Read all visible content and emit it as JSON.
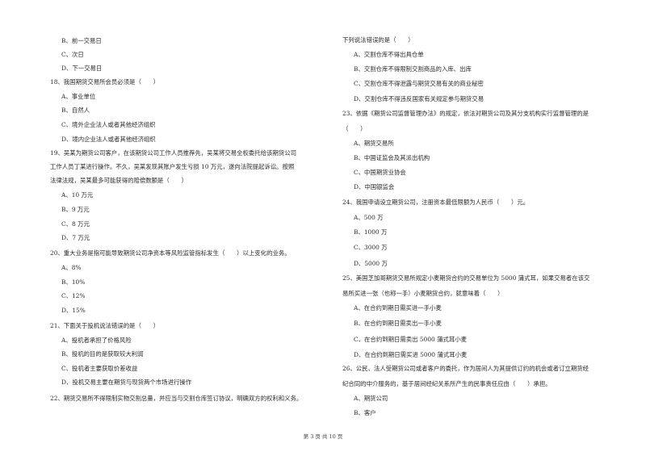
{
  "left_column": [
    {
      "type": "opt",
      "text": "B、前一交易日"
    },
    {
      "type": "opt",
      "text": "C、次日"
    },
    {
      "type": "opt",
      "text": "D、下一交易日"
    },
    {
      "type": "q",
      "text": "18、我国期货交易所会员必须是（　　）"
    },
    {
      "type": "opt",
      "text": "A、事业单位"
    },
    {
      "type": "opt",
      "text": "B、自然人"
    },
    {
      "type": "opt",
      "text": "C、境外企业法人或者其他经济组织"
    },
    {
      "type": "opt",
      "text": "D、境内企业法人或者其他经济组织"
    },
    {
      "type": "q",
      "text": "19、吴某为期货公司客户，在该期货公司工作人员推荐先，吴某将交易全权委托给该期货公司"
    },
    {
      "type": "q",
      "text": "工作人员丁某进行操作。不久，吴某发现其账户发生亏损 10 万元，遂向法院提起诉讼。按照"
    },
    {
      "type": "q",
      "text": "法律法规，吴某最多可能获得的赔偿数额是（　　）"
    },
    {
      "type": "opt",
      "text": "A、10 万元"
    },
    {
      "type": "opt",
      "text": "B、9 万元"
    },
    {
      "type": "opt",
      "text": "C、8 万元"
    },
    {
      "type": "opt",
      "text": "D、7 万元"
    },
    {
      "type": "q",
      "text": "20、重大业务是指可能导致期货公司净资本等风险监管指标发生（　　）以上变化的业务。"
    },
    {
      "type": "opt",
      "text": "A、8%"
    },
    {
      "type": "opt",
      "text": "B、10%"
    },
    {
      "type": "opt",
      "text": "C、12%"
    },
    {
      "type": "opt",
      "text": "D、15%"
    },
    {
      "type": "q",
      "text": "21、下面关于投机说法错误的是（　　）"
    },
    {
      "type": "opt",
      "text": "A、投机者承担了价格风险"
    },
    {
      "type": "opt",
      "text": "B、投机的目的是获取较大利润"
    },
    {
      "type": "opt",
      "text": "C、投机者主要获取价差收益"
    },
    {
      "type": "opt",
      "text": "D、投机交易主要在期货与现货两个市场进行操作"
    },
    {
      "type": "q",
      "text": "22、期货交易所不得限制实物交割总量，并应当与交割仓库签订协议，明确双方的权利和义务。"
    }
  ],
  "right_column": [
    {
      "type": "q",
      "text": "下列说法错误的是（　　）"
    },
    {
      "type": "opt",
      "text": "A、交割仓库不得出具仓单"
    },
    {
      "type": "opt",
      "text": "B、交割仓库不得限制交割商品的入库、出库"
    },
    {
      "type": "opt",
      "text": "C、交割仓库不得泄露与期货交易有关的商业秘密"
    },
    {
      "type": "opt",
      "text": "D、交割仓库不得违反国家有关规定参与期货交易"
    },
    {
      "type": "q",
      "text": "23、依据《期货公司监督管理办法》的规定，依法对期货公司及其分支机构实行监督管理的是"
    },
    {
      "type": "q",
      "text": "（　　）"
    },
    {
      "type": "opt",
      "text": "A、期货交易所"
    },
    {
      "type": "opt",
      "text": "B、中国证监会及其派出机构"
    },
    {
      "type": "opt",
      "text": "C、中国期货业协会"
    },
    {
      "type": "opt",
      "text": "D、中国银监会"
    },
    {
      "type": "q",
      "text": "24、我国申请设立期货公司，注册资本最低限额为人民币（　　）元。"
    },
    {
      "type": "opt",
      "text": "A、500 万"
    },
    {
      "type": "opt",
      "text": "B、1000 万"
    },
    {
      "type": "opt",
      "text": "C、3000 万"
    },
    {
      "type": "opt",
      "text": "D、5000 万"
    },
    {
      "type": "q",
      "text": "25、美国芝加哥期货交易所规定小麦期货合约的交易单位为 5000 蒲式耳，如果交易者在该交"
    },
    {
      "type": "q",
      "text": "易所买进一张（也称一手）小麦期货合约，就意味着（　　）"
    },
    {
      "type": "opt",
      "text": "A、在合约到期日需买进一手小麦"
    },
    {
      "type": "opt",
      "text": "B、在合约到期日需卖出一手小麦"
    },
    {
      "type": "opt",
      "text": "C、在合约到期日需卖出 5000 蒲式耳小麦"
    },
    {
      "type": "opt",
      "text": "D、在合约到期日需买进 5000 蒲式耳小麦"
    },
    {
      "type": "q",
      "text": "26、公民、法人受期货公司或者客户的委托，作为居间人为其提供订约的机会或者订立期货经"
    },
    {
      "type": "q",
      "text": "纪合同的中介服务的，基于居间经纪关系所产生的民事责任应由（　　）承担。"
    },
    {
      "type": "opt",
      "text": "A、期货公司"
    },
    {
      "type": "opt",
      "text": "B、客户"
    }
  ],
  "footer": {
    "page_label": "第 3 页 共 10 页"
  }
}
